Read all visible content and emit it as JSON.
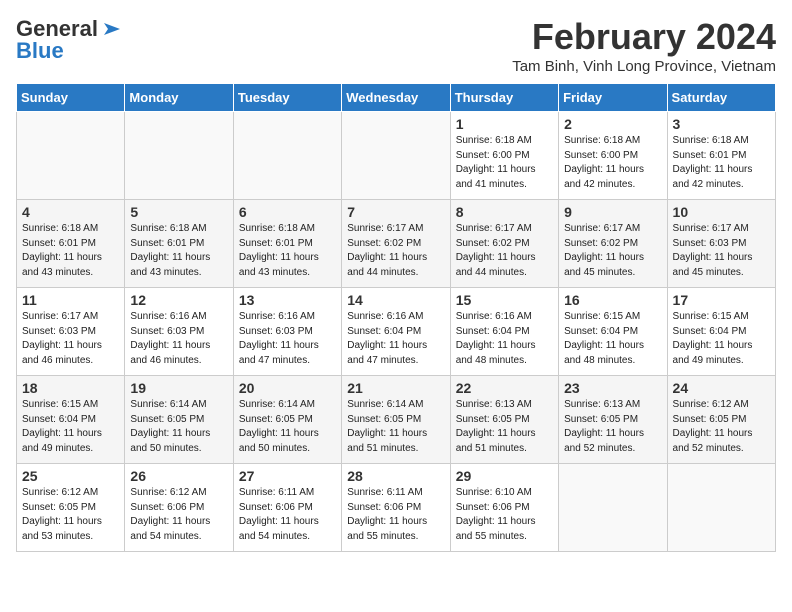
{
  "logo": {
    "line1": "General",
    "line2": "Blue"
  },
  "title": "February 2024",
  "subtitle": "Tam Binh, Vinh Long Province, Vietnam",
  "days_of_week": [
    "Sunday",
    "Monday",
    "Tuesday",
    "Wednesday",
    "Thursday",
    "Friday",
    "Saturday"
  ],
  "weeks": [
    [
      {
        "day": "",
        "info": ""
      },
      {
        "day": "",
        "info": ""
      },
      {
        "day": "",
        "info": ""
      },
      {
        "day": "",
        "info": ""
      },
      {
        "day": "1",
        "info": "Sunrise: 6:18 AM\nSunset: 6:00 PM\nDaylight: 11 hours\nand 41 minutes."
      },
      {
        "day": "2",
        "info": "Sunrise: 6:18 AM\nSunset: 6:00 PM\nDaylight: 11 hours\nand 42 minutes."
      },
      {
        "day": "3",
        "info": "Sunrise: 6:18 AM\nSunset: 6:01 PM\nDaylight: 11 hours\nand 42 minutes."
      }
    ],
    [
      {
        "day": "4",
        "info": "Sunrise: 6:18 AM\nSunset: 6:01 PM\nDaylight: 11 hours\nand 43 minutes."
      },
      {
        "day": "5",
        "info": "Sunrise: 6:18 AM\nSunset: 6:01 PM\nDaylight: 11 hours\nand 43 minutes."
      },
      {
        "day": "6",
        "info": "Sunrise: 6:18 AM\nSunset: 6:01 PM\nDaylight: 11 hours\nand 43 minutes."
      },
      {
        "day": "7",
        "info": "Sunrise: 6:17 AM\nSunset: 6:02 PM\nDaylight: 11 hours\nand 44 minutes."
      },
      {
        "day": "8",
        "info": "Sunrise: 6:17 AM\nSunset: 6:02 PM\nDaylight: 11 hours\nand 44 minutes."
      },
      {
        "day": "9",
        "info": "Sunrise: 6:17 AM\nSunset: 6:02 PM\nDaylight: 11 hours\nand 45 minutes."
      },
      {
        "day": "10",
        "info": "Sunrise: 6:17 AM\nSunset: 6:03 PM\nDaylight: 11 hours\nand 45 minutes."
      }
    ],
    [
      {
        "day": "11",
        "info": "Sunrise: 6:17 AM\nSunset: 6:03 PM\nDaylight: 11 hours\nand 46 minutes."
      },
      {
        "day": "12",
        "info": "Sunrise: 6:16 AM\nSunset: 6:03 PM\nDaylight: 11 hours\nand 46 minutes."
      },
      {
        "day": "13",
        "info": "Sunrise: 6:16 AM\nSunset: 6:03 PM\nDaylight: 11 hours\nand 47 minutes."
      },
      {
        "day": "14",
        "info": "Sunrise: 6:16 AM\nSunset: 6:04 PM\nDaylight: 11 hours\nand 47 minutes."
      },
      {
        "day": "15",
        "info": "Sunrise: 6:16 AM\nSunset: 6:04 PM\nDaylight: 11 hours\nand 48 minutes."
      },
      {
        "day": "16",
        "info": "Sunrise: 6:15 AM\nSunset: 6:04 PM\nDaylight: 11 hours\nand 48 minutes."
      },
      {
        "day": "17",
        "info": "Sunrise: 6:15 AM\nSunset: 6:04 PM\nDaylight: 11 hours\nand 49 minutes."
      }
    ],
    [
      {
        "day": "18",
        "info": "Sunrise: 6:15 AM\nSunset: 6:04 PM\nDaylight: 11 hours\nand 49 minutes."
      },
      {
        "day": "19",
        "info": "Sunrise: 6:14 AM\nSunset: 6:05 PM\nDaylight: 11 hours\nand 50 minutes."
      },
      {
        "day": "20",
        "info": "Sunrise: 6:14 AM\nSunset: 6:05 PM\nDaylight: 11 hours\nand 50 minutes."
      },
      {
        "day": "21",
        "info": "Sunrise: 6:14 AM\nSunset: 6:05 PM\nDaylight: 11 hours\nand 51 minutes."
      },
      {
        "day": "22",
        "info": "Sunrise: 6:13 AM\nSunset: 6:05 PM\nDaylight: 11 hours\nand 51 minutes."
      },
      {
        "day": "23",
        "info": "Sunrise: 6:13 AM\nSunset: 6:05 PM\nDaylight: 11 hours\nand 52 minutes."
      },
      {
        "day": "24",
        "info": "Sunrise: 6:12 AM\nSunset: 6:05 PM\nDaylight: 11 hours\nand 52 minutes."
      }
    ],
    [
      {
        "day": "25",
        "info": "Sunrise: 6:12 AM\nSunset: 6:05 PM\nDaylight: 11 hours\nand 53 minutes."
      },
      {
        "day": "26",
        "info": "Sunrise: 6:12 AM\nSunset: 6:06 PM\nDaylight: 11 hours\nand 54 minutes."
      },
      {
        "day": "27",
        "info": "Sunrise: 6:11 AM\nSunset: 6:06 PM\nDaylight: 11 hours\nand 54 minutes."
      },
      {
        "day": "28",
        "info": "Sunrise: 6:11 AM\nSunset: 6:06 PM\nDaylight: 11 hours\nand 55 minutes."
      },
      {
        "day": "29",
        "info": "Sunrise: 6:10 AM\nSunset: 6:06 PM\nDaylight: 11 hours\nand 55 minutes."
      },
      {
        "day": "",
        "info": ""
      },
      {
        "day": "",
        "info": ""
      }
    ]
  ]
}
